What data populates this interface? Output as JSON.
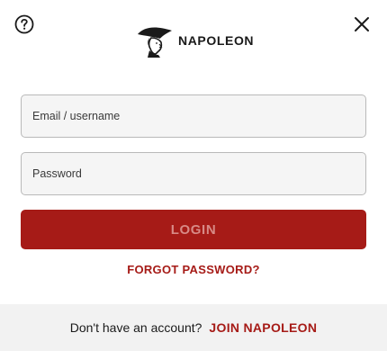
{
  "header": {
    "brand_name": "NAPOLEON",
    "help_icon": "question-circle-icon",
    "close_icon": "close-x-icon"
  },
  "form": {
    "email_placeholder": "Email / username",
    "password_placeholder": "Password",
    "login_label": "LOGIN",
    "forgot_label": "FORGOT PASSWORD?"
  },
  "footer": {
    "prompt_text": "Don't have an account?",
    "join_label": "JOIN NAPOLEON"
  },
  "colors": {
    "brand_red": "#a61b17",
    "login_text": "#d78a86",
    "footer_bg": "#f2f2f2",
    "field_bg": "#f5f5f5"
  }
}
